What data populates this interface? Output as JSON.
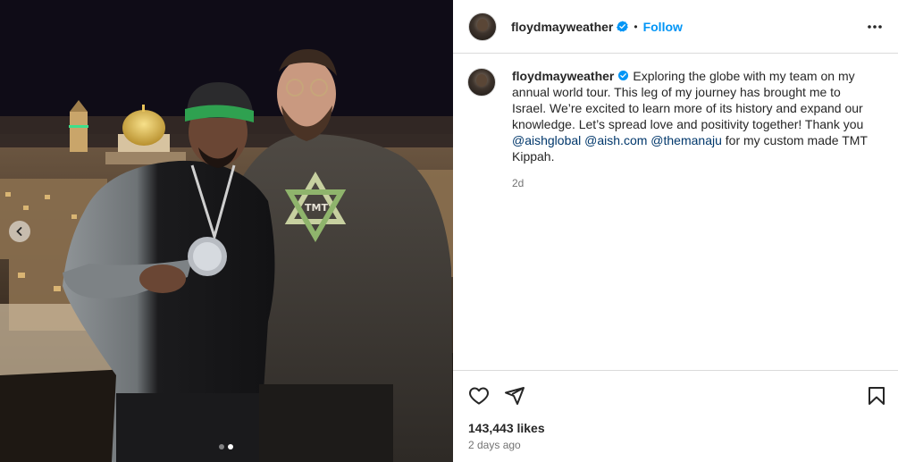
{
  "post": {
    "username": "floydmayweather",
    "follow_label": "Follow",
    "separator": "•",
    "caption": {
      "text_1": "Exploring the globe with my team on my annual world tour. This leg of my journey has brought me to Israel. We’re excited to learn more of its history and expand our knowledge. Let’s spread love and positivity together! Thank you ",
      "mention_1": "@aishglobal",
      "mention_2": "@aish.com",
      "mention_3": "@themanaju",
      "text_2": " for my custom made TMT Kippah."
    },
    "caption_time": "2d",
    "likes": "143,443 likes",
    "posted_ago": "2 days ago"
  },
  "media": {
    "carousel_total": 2,
    "carousel_active": 2
  },
  "icons": {
    "verified": "verified-badge-icon",
    "more": "more-options-icon",
    "like": "heart-icon",
    "share": "paper-plane-icon",
    "save": "bookmark-icon",
    "prev": "chevron-left-icon"
  },
  "colors": {
    "accent": "#0095f6",
    "mention": "#00376b",
    "verified": "#0095f6",
    "muted": "#737373",
    "border": "#dbdbdb"
  }
}
